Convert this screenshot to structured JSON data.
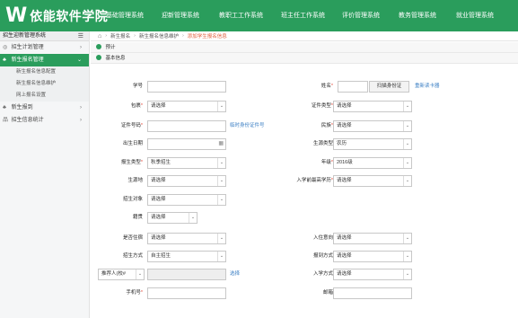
{
  "header": {
    "logo_mark": "W",
    "logo_text": "依能软件学院",
    "nav": [
      "基础管理系统",
      "迎新管理系统",
      "教职工工作系统",
      "班主任工作系统",
      "评价管理系统",
      "教务管理系统",
      "就业管理系统"
    ]
  },
  "sidebar": {
    "title": "招生迎新管理系统",
    "items": [
      {
        "label": "招生计划管理",
        "icon": "◎",
        "chev": "›"
      },
      {
        "label": "新生报名管理",
        "icon": "♣",
        "chev": "⌄"
      },
      {
        "label": "新生报到",
        "icon": "♣",
        "chev": "›"
      },
      {
        "label": "招生信息统计",
        "icon": "品",
        "chev": "›"
      }
    ],
    "subitems": [
      "新生报名信息配置",
      "新生报名信息维护",
      "网上报名设置"
    ]
  },
  "breadcrumb": {
    "home_icon": "⌂",
    "items": [
      "新生报名",
      "新生报名信息维护",
      "添加学生报名信息"
    ]
  },
  "sections": {
    "notice": "预计",
    "basic": "基本信息"
  },
  "form": {
    "student_no_label": "学号",
    "name_label": "姓名",
    "scan_id_button": "扫描身份证",
    "read_card_link": "重新读卡器",
    "bag_label": "包裹",
    "bag_value": "请选择",
    "id_type_label": "证件类型",
    "id_type_value": "请选择",
    "id_no_label": "证件号码",
    "temp_id_link": "临时身份证件号",
    "ethnicity_label": "民族",
    "ethnicity_value": "请选择",
    "birth_label": "出生日期",
    "origin_type_label": "生源类型",
    "origin_type_value": "农历",
    "enroll_type_label": "报生类型",
    "enroll_type_value": "秋季招生",
    "grade_label": "年级",
    "grade_value": "2016级",
    "source_label": "生源地",
    "source_value": "请选择",
    "pre_edu_label": "入学前最高学历",
    "pre_edu_value": "请选择",
    "target_label": "招生对象",
    "target_value": "请选择",
    "origin_label": "籍贯",
    "origin_value": "请选择",
    "boarding_label": "是否住宿",
    "boarding_value": "请选择",
    "intent_label": "入住意向",
    "intent_value": "请选择",
    "method_label": "招生方式",
    "method_value": "自主招生",
    "report_method_label": "报到方式",
    "report_method_value": "请选择",
    "referrer_select": "推荐人(校#",
    "select_link": "选择",
    "admission_label": "入学方式",
    "admission_value": "请选择",
    "phone_label": "手机号",
    "email_label": "邮箱"
  },
  "colors": {
    "brand": "#2a9d5c",
    "required": "#e74c3c",
    "link": "#3b7fc4",
    "crumb_current": "#e05d3a"
  }
}
